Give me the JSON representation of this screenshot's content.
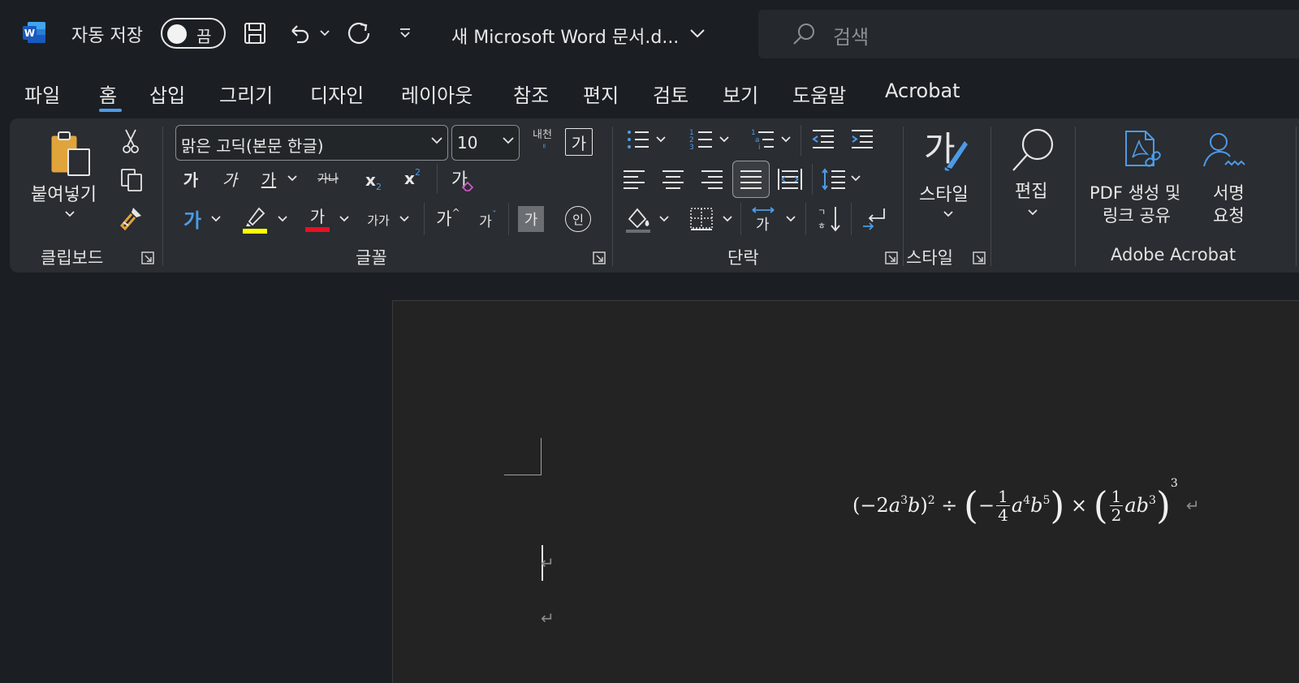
{
  "titlebar": {
    "autosave_label": "자동 저장",
    "autosave_state": "끔",
    "doc_title": "새 Microsoft Word 문서.d...",
    "search_placeholder": "검색"
  },
  "tabs": [
    "파일",
    "홈",
    "삽입",
    "그리기",
    "디자인",
    "레이아웃",
    "참조",
    "편지",
    "검토",
    "보기",
    "도움말",
    "Acrobat"
  ],
  "active_tab": "홈",
  "ribbon": {
    "clipboard": {
      "paste_label": "붙여넣기",
      "group_label": "클립보드"
    },
    "font": {
      "font_name": "맑은 고딕(본문 한글)",
      "font_size": "10",
      "bold": "가",
      "italic": "가",
      "underline": "가",
      "strike": "가나",
      "subscript": "x",
      "subscript_mark": "2",
      "superscript": "x",
      "superscript_mark": "2",
      "clear_format": "가",
      "text_effects": "가",
      "font_color": "가",
      "change_case": "가가",
      "grow_font": "가",
      "shrink_font": "가",
      "char_shading": "가",
      "enclose_char": "인",
      "phonetic": "내천",
      "char_border": "가",
      "group_label": "글꼴"
    },
    "paragraph": {
      "group_label": "단락",
      "sort_label": "ㄱ ㅎ"
    },
    "styles": {
      "label": "스타일",
      "icon_char": "가",
      "group_label": "스타일"
    },
    "editing": {
      "label": "편집"
    },
    "acrobat": {
      "pdf_line1": "PDF 생성 및",
      "pdf_line2": "링크 공유",
      "sign_line1": "서명",
      "sign_line2": "요청",
      "group_label": "Adobe Acrobat"
    }
  },
  "document": {
    "paragraph_mark": "↵"
  },
  "colors": {
    "accent": "#4c9be8",
    "highlight_yellow": "#ffff00",
    "font_color_red": "#e81123",
    "word_blue": "#185abd"
  }
}
